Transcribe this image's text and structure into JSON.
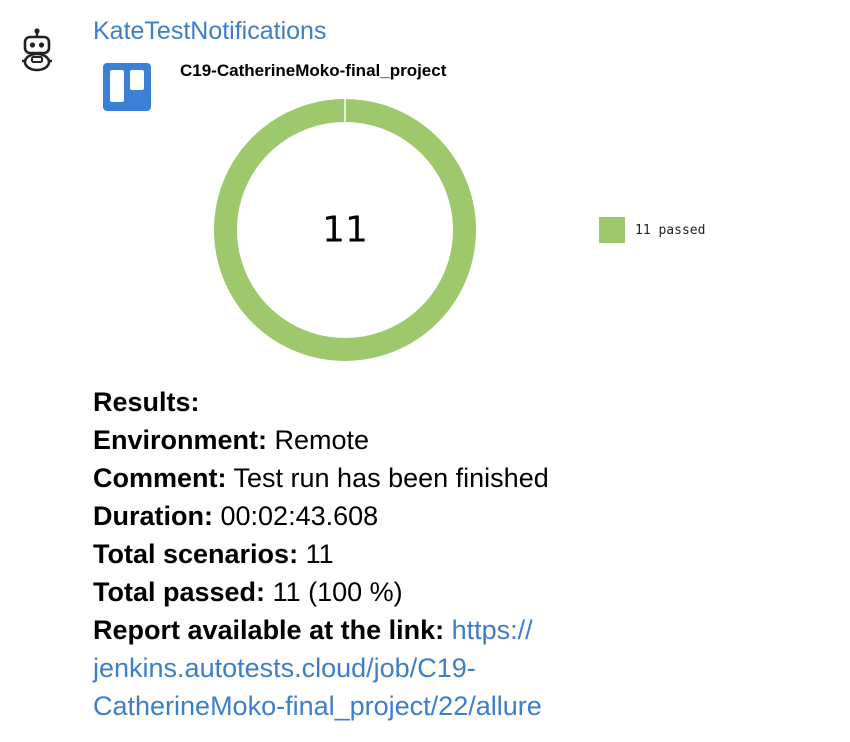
{
  "message": {
    "sender": "KateTestNotifications",
    "avatar_icon": "robot-icon",
    "attachment": {
      "app_icon": "trello-icon",
      "project_title": "C19-CatherineMoko-final_project"
    },
    "results": {
      "heading": "Results:",
      "environment_label": "Environment:",
      "environment_value": "Remote",
      "comment_label": "Comment:",
      "comment_value": "Test run has been finished",
      "duration_label": "Duration:",
      "duration_value": "00:02:43.608",
      "total_scenarios_label": "Total scenarios:",
      "total_scenarios_value": "11",
      "total_passed_label": "Total passed:",
      "total_passed_value": "11 (100 %)",
      "report_label": "Report available at the link:",
      "report_link_line1": "https://",
      "report_link_line2": "jenkins.autotests.cloud/job/C19-",
      "report_link_line3": "CatherineMoko-final_project/22/allure"
    }
  },
  "chart_data": {
    "type": "pie",
    "center_label": "11",
    "series": [
      {
        "name": "11 passed",
        "value": 11,
        "color": "#9dc86c"
      }
    ]
  },
  "colors": {
    "link": "#3d7ec9",
    "trello_blue": "#3a80d6",
    "passed_green": "#9dc86c"
  }
}
